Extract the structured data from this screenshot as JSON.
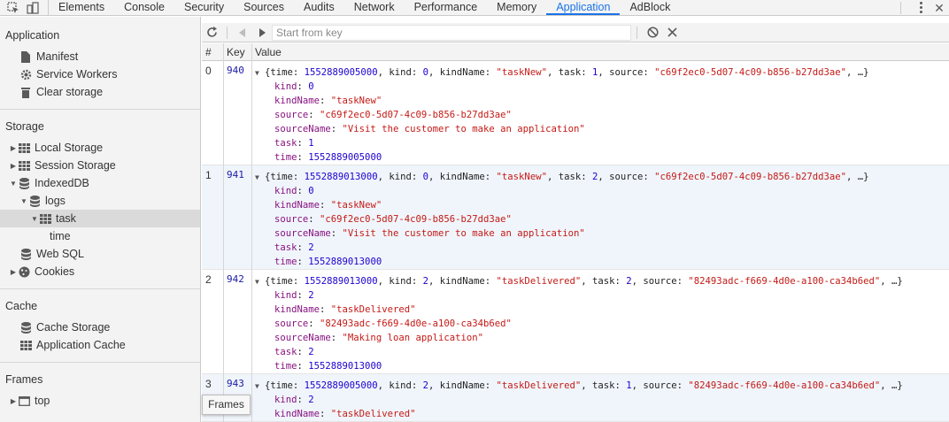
{
  "tabs": [
    "Elements",
    "Console",
    "Security",
    "Sources",
    "Audits",
    "Network",
    "Performance",
    "Memory",
    "Application",
    "AdBlock"
  ],
  "active_tab": "Application",
  "sidebar": {
    "application": {
      "title": "Application",
      "manifest": "Manifest",
      "service_workers": "Service Workers",
      "clear_storage": "Clear storage"
    },
    "storage": {
      "title": "Storage",
      "local_storage": "Local Storage",
      "session_storage": "Session Storage",
      "indexeddb": "IndexedDB",
      "logs": "logs",
      "task": "task",
      "time": "time",
      "web_sql": "Web SQL",
      "cookies": "Cookies"
    },
    "cache": {
      "title": "Cache",
      "cache_storage": "Cache Storage",
      "application_cache": "Application Cache"
    },
    "frames": {
      "title": "Frames",
      "top": "top"
    }
  },
  "toolbar": {
    "placeholder": "Start from key"
  },
  "grid": {
    "headers": {
      "index": "#",
      "key": "Key",
      "value": "Value"
    },
    "rows": [
      {
        "index": "0",
        "key": "940",
        "summary": [
          "{time: ",
          "1552889005000",
          ", kind: ",
          "0",
          ", kindName: ",
          "\"taskNew\"",
          ", task: ",
          "1",
          ", source: ",
          "\"c69f2ec0-5d07-4c09-b856-b27dd3ae\"",
          ", …}"
        ],
        "props": [
          [
            "kind",
            "0",
            "num"
          ],
          [
            "kindName",
            "\"taskNew\"",
            "str"
          ],
          [
            "source",
            "\"c69f2ec0-5d07-4c09-b856-b27dd3ae\"",
            "str"
          ],
          [
            "sourceName",
            "\"Visit the customer to make an application\"",
            "str"
          ],
          [
            "task",
            "1",
            "num"
          ],
          [
            "time",
            "1552889005000",
            "num"
          ]
        ]
      },
      {
        "index": "1",
        "key": "941",
        "summary": [
          "{time: ",
          "1552889013000",
          ", kind: ",
          "0",
          ", kindName: ",
          "\"taskNew\"",
          ", task: ",
          "2",
          ", source: ",
          "\"c69f2ec0-5d07-4c09-b856-b27dd3ae\"",
          ", …}"
        ],
        "props": [
          [
            "kind",
            "0",
            "num"
          ],
          [
            "kindName",
            "\"taskNew\"",
            "str"
          ],
          [
            "source",
            "\"c69f2ec0-5d07-4c09-b856-b27dd3ae\"",
            "str"
          ],
          [
            "sourceName",
            "\"Visit the customer to make an application\"",
            "str"
          ],
          [
            "task",
            "2",
            "num"
          ],
          [
            "time",
            "1552889013000",
            "num"
          ]
        ]
      },
      {
        "index": "2",
        "key": "942",
        "summary": [
          "{time: ",
          "1552889013000",
          ", kind: ",
          "2",
          ", kindName: ",
          "\"taskDelivered\"",
          ", task: ",
          "2",
          ", source: ",
          "\"82493adc-f669-4d0e-a100-ca34b6ed\"",
          ", …}"
        ],
        "props": [
          [
            "kind",
            "2",
            "num"
          ],
          [
            "kindName",
            "\"taskDelivered\"",
            "str"
          ],
          [
            "source",
            "\"82493adc-f669-4d0e-a100-ca34b6ed\"",
            "str"
          ],
          [
            "sourceName",
            "\"Making loan application\"",
            "str"
          ],
          [
            "task",
            "2",
            "num"
          ],
          [
            "time",
            "1552889013000",
            "num"
          ]
        ]
      },
      {
        "index": "3",
        "key": "943",
        "summary": [
          "{time: ",
          "1552889005000",
          ", kind: ",
          "2",
          ", kindName: ",
          "\"taskDelivered\"",
          ", task: ",
          "1",
          ", source: ",
          "\"82493adc-f669-4d0e-a100-ca34b6ed\"",
          ", …}"
        ],
        "props": [
          [
            "kind",
            "2",
            "num"
          ],
          [
            "kindName",
            "\"taskDelivered\"",
            "str"
          ]
        ]
      }
    ]
  },
  "tooltip": "Frames",
  "colors": {
    "accent": "#1a73e8",
    "key": "#1a1aa6",
    "prop": "#881280",
    "number": "#1c00cf",
    "string": "#c41a16",
    "alt_row": "#f0f5fb"
  }
}
